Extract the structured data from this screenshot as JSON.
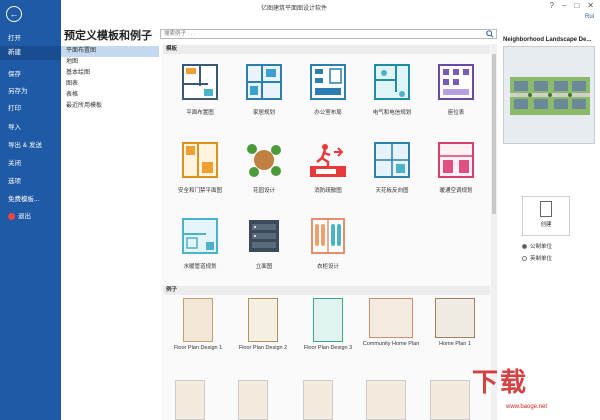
{
  "app": {
    "title": "亿图建筑平面图设计软件",
    "user": "Rui"
  },
  "sidebar": {
    "items": [
      {
        "label": "打开"
      },
      {
        "label": "新建"
      },
      {
        "label": "保存"
      },
      {
        "label": "另存为"
      },
      {
        "label": "打印"
      },
      {
        "label": "导入"
      },
      {
        "label": "导出 & 发送"
      },
      {
        "label": "关闭"
      },
      {
        "label": "选项"
      },
      {
        "label": "免费模板..."
      },
      {
        "label": "退出"
      }
    ]
  },
  "main": {
    "heading": "预定义模板和例子",
    "search_placeholder": "搜索例子 . . .",
    "categories": [
      "平面布置图",
      "地图",
      "基本绘图",
      "图表",
      "表格",
      "最近所用模板"
    ],
    "templates_header": "模板",
    "templates": [
      "平面布置图",
      "家居规划",
      "办公室布局",
      "电气和电信规划",
      "座位表",
      "安全和门禁平面图",
      "花园设计",
      "消防疏散图",
      "天花板反向图",
      "暖通空调规划",
      "水暖管道规划",
      "立面图",
      "衣柜设计"
    ],
    "examples_header": "例子",
    "examples": [
      "Floor Plan Design 1",
      "Floor Plan Design 2",
      "Floor Plan Design 3",
      "Community Home Plan",
      "Home Plan 1"
    ]
  },
  "preview": {
    "title": "Neighborhood Landscape De...",
    "create_label": "创建",
    "units": [
      "公制单位",
      "英制单位"
    ],
    "selected_unit": "公制单位"
  },
  "watermark": {
    "text": "下载",
    "url": "www.baoge.net"
  },
  "colors": {
    "sidebar": "#1f5aa6",
    "selected_category": "#c5d9f0",
    "accent": "#2b579a"
  }
}
